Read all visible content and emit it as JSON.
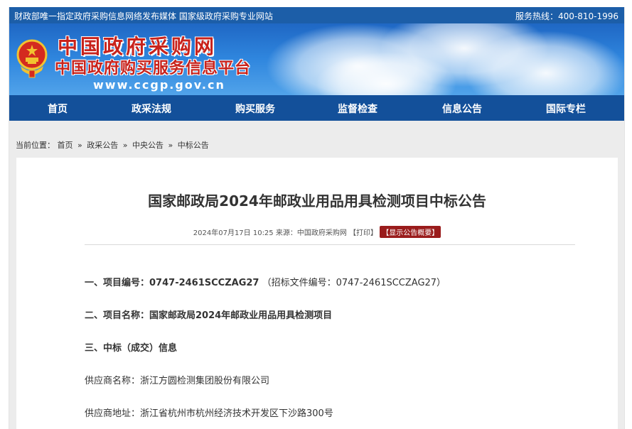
{
  "topbar": {
    "left": "财政部唯一指定政府采购信息网络发布媒体 国家级政府采购专业网站",
    "right": "服务热线：400-810-1996"
  },
  "header": {
    "title": "中国政府采购网",
    "subtitle": "中国政府购买服务信息平台",
    "url": "www.ccgp.gov.cn"
  },
  "nav": {
    "items": [
      {
        "label": "首页"
      },
      {
        "label": "政采法规"
      },
      {
        "label": "购买服务"
      },
      {
        "label": "监督检查"
      },
      {
        "label": "信息公告"
      },
      {
        "label": "国际专栏"
      }
    ]
  },
  "breadcrumb": {
    "prefix": "当前位置：",
    "items": [
      "首页",
      "政采公告",
      "中央公告",
      "中标公告"
    ],
    "separator": "»"
  },
  "article": {
    "title": "国家邮政局2024年邮政业用品用具检测项目中标公告",
    "datetime": "2024年07月17日 10:25",
    "source": "来源：中国政府采购网",
    "print": "【打印】",
    "summary_badge": "【显示公告概要】",
    "lines": [
      {
        "label": "一、项目编号：",
        "value": "0747-2461SCCZAG27",
        "extra": "（招标文件编号：0747-2461SCCZAG27）"
      },
      {
        "text": "二、项目名称：国家邮政局2024年邮政业用品用具检测项目"
      },
      {
        "text": "三、中标（成交）信息"
      },
      {
        "text": "供应商名称：浙江方圆检测集团股份有限公司"
      },
      {
        "text": "供应商地址：浙江省杭州市杭州经济技术开发区下沙路300号"
      }
    ]
  },
  "colors": {
    "topbar": "#1c5ea8",
    "nav": "#13509a",
    "title_red": "#c8231c",
    "badge": "#9a1c1c"
  }
}
